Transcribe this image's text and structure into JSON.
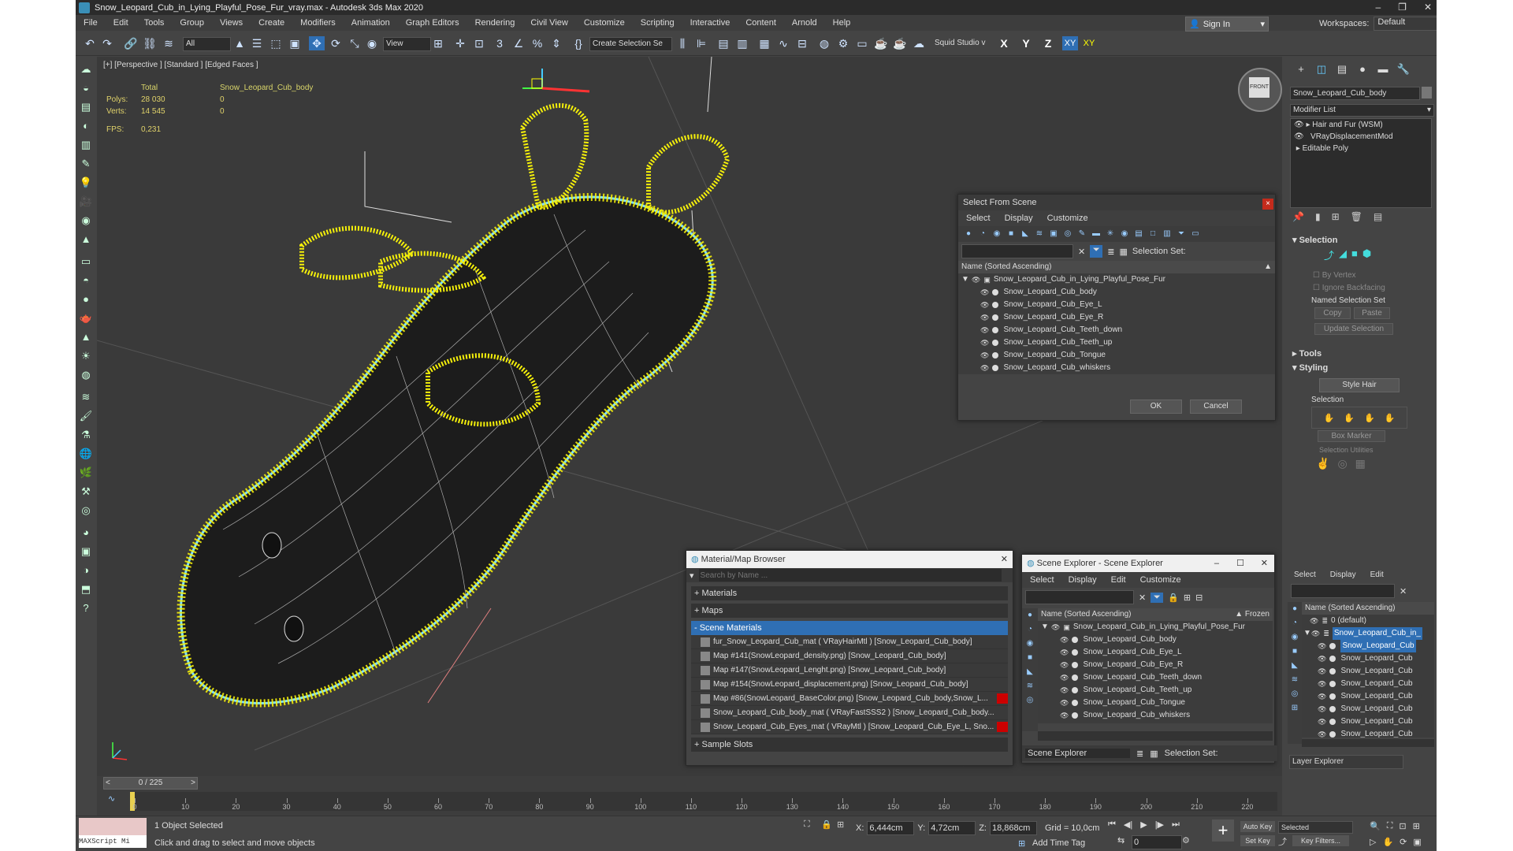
{
  "window": {
    "title": "Snow_Leopard_Cub_in_Lying_Playful_Pose_Fur_vray.max - Autodesk 3ds Max 2020"
  },
  "menu": [
    "File",
    "Edit",
    "Tools",
    "Group",
    "Views",
    "Create",
    "Modifiers",
    "Animation",
    "Graph Editors",
    "Rendering",
    "Civil View",
    "Customize",
    "Scripting",
    "Interactive",
    "Content",
    "Arnold",
    "Help"
  ],
  "header": {
    "sign_in": "Sign In",
    "workspaces_label": "Workspaces:",
    "workspaces_value": "Default"
  },
  "toolbar": {
    "filter": "All",
    "view": "View",
    "selection_set": "Create Selection Se",
    "squid": "Squid Studio v",
    "axes": [
      "X",
      "Y",
      "Z",
      "XY",
      "XY"
    ]
  },
  "viewport": {
    "label": "[+] [Perspective ] [Standard ] [Edged Faces ]",
    "stats_total": "Total",
    "stats_object": "Snow_Leopard_Cub_body",
    "polys_label": "Polys:",
    "polys_total": "28 030",
    "polys_obj": "0",
    "verts_label": "Verts:",
    "verts_total": "14 545",
    "verts_obj": "0",
    "fps_label": "FPS:",
    "fps_value": "0,231",
    "viewcube": "FRONT"
  },
  "select_dialog": {
    "title": "Select From Scene",
    "tabs": [
      "Select",
      "Display",
      "Customize"
    ],
    "selection_set_label": "Selection Set:",
    "column": "Name (Sorted Ascending)",
    "root": "Snow_Leopard_Cub_in_Lying_Playful_Pose_Fur",
    "items": [
      "Snow_Leopard_Cub_body",
      "Snow_Leopard_Cub_Eye_L",
      "Snow_Leopard_Cub_Eye_R",
      "Snow_Leopard_Cub_Teeth_down",
      "Snow_Leopard_Cub_Teeth_up",
      "Snow_Leopard_Cub_Tongue",
      "Snow_Leopard_Cub_whiskers"
    ],
    "ok": "OK",
    "cancel": "Cancel"
  },
  "material_browser": {
    "title": "Material/Map Browser",
    "search_placeholder": "Search by Name ...",
    "sections": {
      "materials": "+ Materials",
      "maps": "+ Maps",
      "scene_materials": "- Scene Materials",
      "sample_slots": "+ Sample Slots"
    },
    "rows": [
      "fur_Snow_Leopard_Cub_mat ( VRayHairMtl ) [Snow_Leopard_Cub_body]",
      "Map #141(SnowLeopard_density.png) [Snow_Leopard_Cub_body]",
      "Map #147(SnowLeopard_Lenght.png) [Snow_Leopard_Cub_body]",
      "Map #154(SnowLeopard_displacement.png) [Snow_Leopard_Cub_body]",
      "Map #86(SnowLeopard_BaseColor.png) [Snow_Leopard_Cub_body,Snow_L...",
      "Snow_Leopard_Cub_body_mat ( VRayFastSSS2 ) [Snow_Leopard_Cub_body...",
      "Snow_Leopard_Cub_Eyes_mat ( VRayMtl ) [Snow_Leopard_Cub_Eye_L, Sno..."
    ]
  },
  "scene_explorer": {
    "title": "Scene Explorer - Scene Explorer",
    "tabs": [
      "Select",
      "Display",
      "Edit",
      "Customize"
    ],
    "column": "Name (Sorted Ascending)",
    "frozen": "▲ Frozen",
    "root": "Snow_Leopard_Cub_in_Lying_Playful_Pose_Fur",
    "items": [
      "Snow_Leopard_Cub_body",
      "Snow_Leopard_Cub_Eye_L",
      "Snow_Leopard_Cub_Eye_R",
      "Snow_Leopard_Cub_Teeth_down",
      "Snow_Leopard_Cub_Teeth_up",
      "Snow_Leopard_Cub_Tongue",
      "Snow_Leopard_Cub_whiskers"
    ],
    "footer_name": "Scene Explorer",
    "selection_set": "Selection Set:"
  },
  "command_panel": {
    "object_name": "Snow_Leopard_Cub_body",
    "modifier_list": "Modifier List",
    "modifiers": [
      "Hair and Fur (WSM)",
      "VRayDisplacementMod",
      "Editable Poly"
    ],
    "selection_title": "Selection",
    "by_vertex": "By Vertex",
    "ignore_backfacing": "Ignore Backfacing",
    "named_selection_set": "Named Selection Set",
    "copy": "Copy",
    "paste": "Paste",
    "update_selection": "Update Selection",
    "tools": "Tools",
    "styling": "Styling",
    "style_hair": "Style Hair",
    "selection_sub": "Selection",
    "box_marker": "Box Marker",
    "selection_utilities": "Selection Utilities"
  },
  "layer_explorer": {
    "tabs": [
      "Select",
      "Display",
      "Edit"
    ],
    "column": "Name (Sorted Ascending)",
    "default_layer": "0 (default)",
    "root_short": "Snow_Leopard_Cub_in_",
    "items": [
      "Snow_Leopard_Cub",
      "Snow_Leopard_Cub",
      "Snow_Leopard_Cub",
      "Snow_Leopard_Cub",
      "Snow_Leopard_Cub",
      "Snow_Leopard_Cub",
      "Snow_Leopard_Cub",
      "Snow_Leopard_Cub"
    ],
    "footer": "Layer Explorer"
  },
  "timeline": {
    "frame": "0 / 225",
    "ticks": [
      "0",
      "10",
      "20",
      "30",
      "40",
      "50",
      "60",
      "70",
      "80",
      "90",
      "100",
      "110",
      "120",
      "130",
      "140",
      "150",
      "160",
      "170",
      "180",
      "190",
      "200",
      "210",
      "220"
    ]
  },
  "status": {
    "maxscript": "MAXScript Mi",
    "selected": "1 Object Selected",
    "hint": "Click and drag to select and move objects",
    "x_label": "X:",
    "x": "6,444cm",
    "y_label": "Y:",
    "y": "4,72cm",
    "z_label": "Z:",
    "z": "18,868cm",
    "grid": "Grid = 10,0cm",
    "add_time_tag": "Add Time Tag",
    "auto_key": "Auto Key",
    "key_mode": "Selected",
    "set_key": "Set Key",
    "key_filters": "Key Filters...",
    "frame": "0"
  },
  "colors": {
    "fur": "#f5f00a",
    "wire": "#ffffff",
    "outline": "#7fe0ff",
    "accent": "#2f6fb4",
    "close": "#c42b1c"
  }
}
